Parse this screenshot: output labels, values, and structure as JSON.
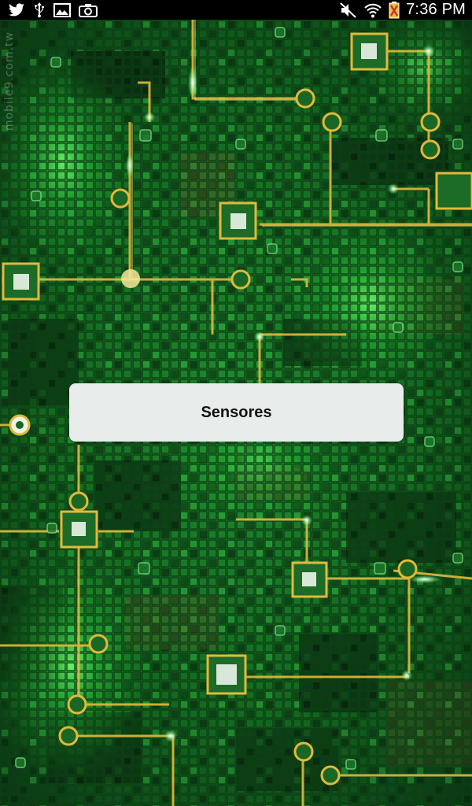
{
  "status_bar": {
    "time": "7:36 PM",
    "left_icons": [
      "twitter-icon",
      "usb-icon",
      "image-icon",
      "camera-icon"
    ],
    "right_icons": [
      "mute-icon",
      "wifi-icon",
      "battery-icon"
    ]
  },
  "wallpaper": {
    "watermark_text": "mobile9.com.tw",
    "colors": {
      "background": "#0a2a10",
      "green": "#22b33a",
      "gold": "#e2b93b"
    }
  },
  "dialog": {
    "label": "Sensores"
  }
}
